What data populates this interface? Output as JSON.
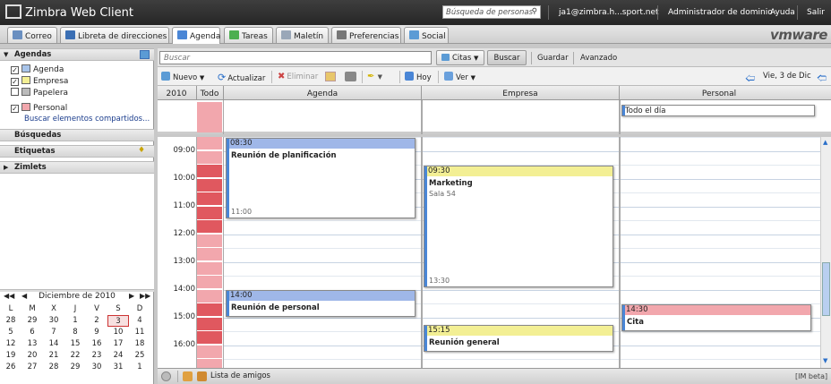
{
  "header": {
    "logo_text": "Zimbra Web Client",
    "search_placeholder": "Búsqueda de personas",
    "user": "ja1@zimbra.h...sport.net",
    "admin_link": "Administrador de dominio",
    "help_link": "Ayuda",
    "logout_link": "Salir"
  },
  "app_tabs": [
    {
      "label": "Correo",
      "color": "#6a8fc0"
    },
    {
      "label": "Libreta de direcciones",
      "color": "#3b6fb4"
    },
    {
      "label": "Agenda",
      "color": "#4a86d6"
    },
    {
      "label": "Tareas",
      "color": "#4caf50"
    },
    {
      "label": "Maletín",
      "color": "#9aa7b8"
    },
    {
      "label": "Preferencias",
      "color": "#777777"
    },
    {
      "label": "Social",
      "color": "#5b9bd5"
    }
  ],
  "brand": "vmware",
  "sidebar": {
    "agendas_title": "Agendas",
    "calendars": [
      {
        "label": "Agenda",
        "checked": true,
        "color": "#a8c4ea"
      },
      {
        "label": "Empresa",
        "checked": true,
        "color": "#f3ef94"
      },
      {
        "label": "Papelera",
        "checked": false,
        "color": "#bbbbbb"
      },
      {
        "label": "Personal",
        "checked": true,
        "color": "#f2a7ad"
      }
    ],
    "shared_link": "Buscar elementos compartidos...",
    "searches_title": "Búsquedas",
    "tags_title": "Etiquetas",
    "zimlets_title": "Zimlets"
  },
  "mini_calendar": {
    "title": "Diciembre de 2010",
    "weekdays": [
      "L",
      "M",
      "X",
      "J",
      "V",
      "S",
      "D"
    ],
    "weeks": [
      [
        "28",
        "29",
        "30",
        "1",
        "2",
        "3",
        "4"
      ],
      [
        "5",
        "6",
        "7",
        "8",
        "9",
        "10",
        "11"
      ],
      [
        "12",
        "13",
        "14",
        "15",
        "16",
        "17",
        "18"
      ],
      [
        "19",
        "20",
        "21",
        "22",
        "23",
        "24",
        "25"
      ],
      [
        "26",
        "27",
        "28",
        "29",
        "30",
        "31",
        "1"
      ]
    ],
    "today": "3"
  },
  "toolbar": {
    "search_placeholder": "Buscar",
    "search_type": "Citas",
    "search_button": "Buscar",
    "save_button": "Guardar",
    "advanced_button": "Avanzado",
    "new_button": "Nuevo",
    "refresh_button": "Actualizar",
    "delete_button": "Eliminar",
    "today_button": "Hoy",
    "view_button": "Ver",
    "current_date": "Vie, 3 de Dic"
  },
  "columns": {
    "year": "2010",
    "all": "Todo",
    "cal1": "Agenda",
    "cal2": "Empresa",
    "cal3": "Personal"
  },
  "allday_event": "Todo el día",
  "hours": [
    "09:00",
    "10:00",
    "11:00",
    "12:00",
    "13:00",
    "14:00",
    "15:00",
    "16:00"
  ],
  "appointments": [
    {
      "column": 0,
      "start": "08:30",
      "end": "11:00",
      "title": "Reunión de planificación",
      "location": "",
      "color": "#9fb7e8"
    },
    {
      "column": 1,
      "start": "09:30",
      "end": "13:30",
      "title": "Marketing",
      "location": "Sala 54",
      "color": "#f3ef94"
    },
    {
      "column": 0,
      "start": "14:00",
      "end": "",
      "title": "Reunión de personal",
      "location": "",
      "color": "#9fb7e8"
    },
    {
      "column": 2,
      "start": "14:30",
      "end": "",
      "title": "Cita",
      "location": "",
      "color": "#f2a7ad"
    },
    {
      "column": 1,
      "start": "15:15",
      "end": "",
      "title": "Reunión general",
      "location": "",
      "color": "#f3ef94"
    }
  ],
  "status": {
    "buddy_list": "Lista de amigos",
    "im_beta": "[IM beta]"
  }
}
